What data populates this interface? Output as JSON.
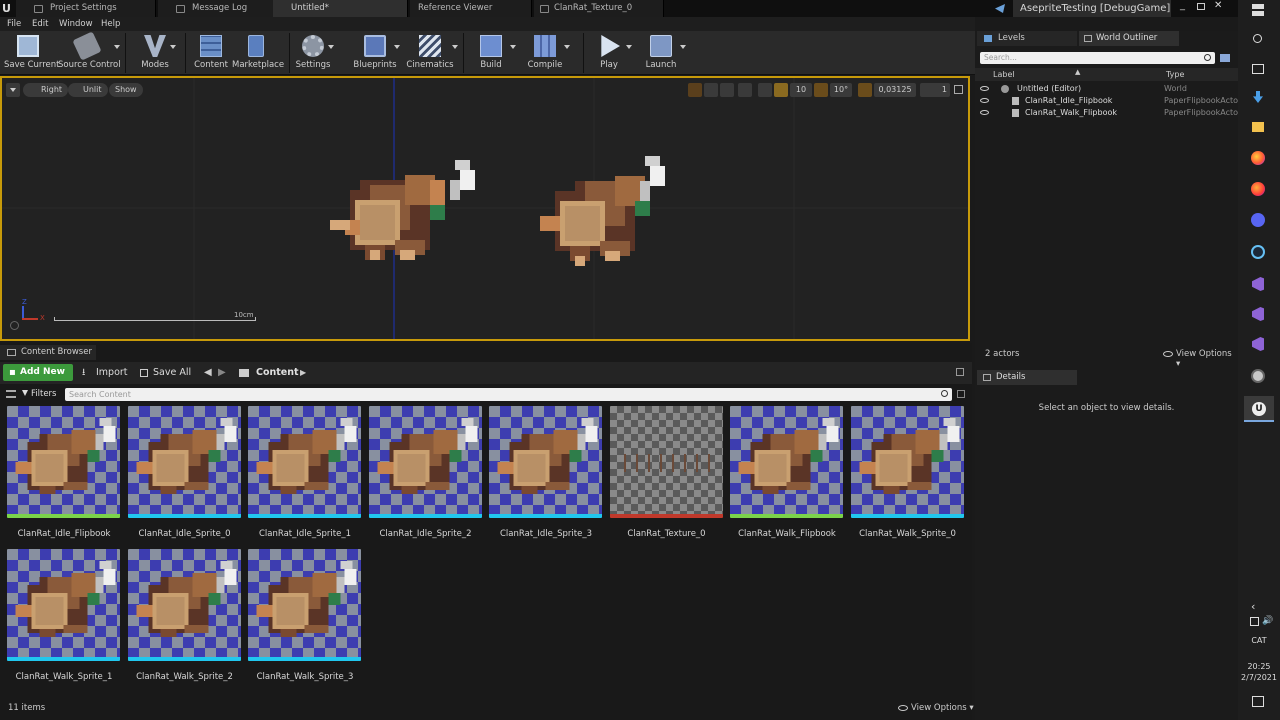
{
  "window": {
    "title": "AsepriteTesting [DebugGame]",
    "tabs": [
      "Project Settings",
      "Message Log",
      "Untitled*",
      "Reference Viewer",
      "ClanRat_Texture_0"
    ]
  },
  "menu": [
    "File",
    "Edit",
    "Window",
    "Help"
  ],
  "toolbar": [
    "Save Current",
    "Source Control",
    "Modes",
    "Content",
    "Marketplace",
    "Settings",
    "Blueprints",
    "Cinematics",
    "Build",
    "Compile",
    "Play",
    "Launch"
  ],
  "viewport": {
    "view_mode": "Right",
    "lighting": "Unlit",
    "show": "Show",
    "grid_snap": "10",
    "rot_snap": "10°",
    "scale_snap": "0,03125",
    "camera_speed": "1",
    "scale_label": "10cm",
    "axis_z": "Z",
    "axis_x": "X"
  },
  "content_browser": {
    "tab_label": "Content Browser",
    "add_new": "Add New",
    "import": "Import",
    "save_all": "Save All",
    "path": "Content",
    "filters": "Filters",
    "search_placeholder": "Search Content",
    "items_count": "11 items",
    "view_options": "View Options",
    "assets": [
      {
        "name": "ClanRat_Idle_Flipbook",
        "bar": "#7bd34a",
        "kind": "sprite"
      },
      {
        "name": "ClanRat_Idle_Sprite_0",
        "bar": "#21c7ee",
        "kind": "sprite"
      },
      {
        "name": "ClanRat_Idle_Sprite_1",
        "bar": "#21c7ee",
        "kind": "sprite"
      },
      {
        "name": "ClanRat_Idle_Sprite_2",
        "bar": "#21c7ee",
        "kind": "sprite"
      },
      {
        "name": "ClanRat_Idle_Sprite_3",
        "bar": "#21c7ee",
        "kind": "sprite"
      },
      {
        "name": "ClanRat_Texture_0",
        "bar": "#c0392b",
        "kind": "texture"
      },
      {
        "name": "ClanRat_Walk_Flipbook",
        "bar": "#7bd34a",
        "kind": "sprite"
      },
      {
        "name": "ClanRat_Walk_Sprite_0",
        "bar": "#21c7ee",
        "kind": "sprite"
      },
      {
        "name": "ClanRat_Walk_Sprite_1",
        "bar": "#21c7ee",
        "kind": "sprite"
      },
      {
        "name": "ClanRat_Walk_Sprite_2",
        "bar": "#21c7ee",
        "kind": "sprite"
      },
      {
        "name": "ClanRat_Walk_Sprite_3",
        "bar": "#21c7ee",
        "kind": "sprite"
      }
    ]
  },
  "outliner": {
    "tabs": [
      "Levels",
      "World Outliner"
    ],
    "search_placeholder": "Search...",
    "col_label": "Label",
    "col_type": "Type",
    "rows": [
      {
        "label": "Untitled (Editor)",
        "type": "World"
      },
      {
        "label": "ClanRat_Idle_Flipbook",
        "type": "PaperFlipbookActo"
      },
      {
        "label": "ClanRat_Walk_Flipbook",
        "type": "PaperFlipbookActo"
      }
    ],
    "actors": "2 actors",
    "view_options": "View Options"
  },
  "details": {
    "tab": "Details",
    "empty": "Select an object to view details."
  },
  "system": {
    "lang": "CAT",
    "time": "20:25",
    "date": "2/7/2021"
  }
}
